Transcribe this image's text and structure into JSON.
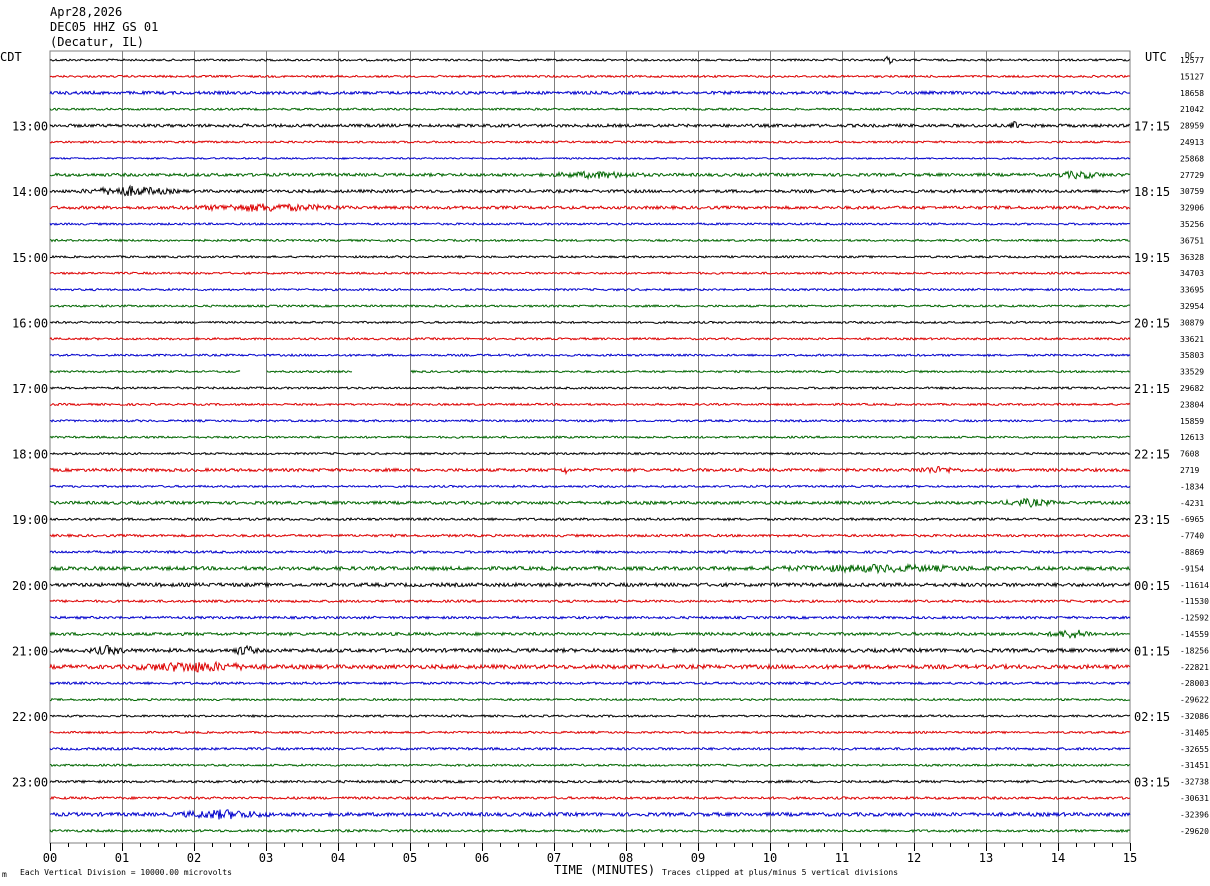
{
  "header": {
    "date": "Apr28,2026",
    "station": "DEC05 HHZ GS 01",
    "location": "(Decatur, IL)"
  },
  "left_tz": "CDT",
  "right_tz": "UTC",
  "dc_label": "DC",
  "footer": {
    "scale_note": "Each Vertical Division = 10000.00 microvolts",
    "xlabel": "TIME (MINUTES)",
    "clip_note": "Traces clipped at plus/minus 5 vertical divisions"
  },
  "colors": {
    "black": "#000000",
    "red": "#dd0000",
    "blue": "#0000cc",
    "green": "#006600",
    "grid": "#7f7f7f"
  },
  "chart_data": {
    "type": "line",
    "title": "DEC05 HHZ GS 01",
    "xlabel": "TIME (MINUTES)",
    "xlim": [
      0,
      15
    ],
    "x_ticks": [
      "00",
      "01",
      "02",
      "03",
      "04",
      "05",
      "06",
      "07",
      "08",
      "09",
      "10",
      "11",
      "12",
      "13",
      "14",
      "15"
    ],
    "trace_color_cycle": [
      "black",
      "red",
      "blue",
      "green"
    ],
    "hour_labels_left": [
      "13:00",
      "14:00",
      "15:00",
      "16:00",
      "17:00",
      "18:00",
      "19:00",
      "20:00",
      "21:00",
      "22:00",
      "23:00"
    ],
    "hour_labels_right": [
      "17:15",
      "18:15",
      "19:15",
      "20:15",
      "21:15",
      "22:15",
      "23:15",
      "00:15",
      "01:15",
      "02:15",
      "03:15"
    ],
    "dc_offsets": [
      "12577",
      "15127",
      "18658",
      "21042",
      "28959",
      "24913",
      "25868",
      "27729",
      "30759",
      "32906",
      "35256",
      "36751",
      "36328",
      "34703",
      "33695",
      "32954",
      "30879",
      "33621",
      "35803",
      "33529",
      "29682",
      "23804",
      "15859",
      "12613",
      "7608",
      "2719",
      "-1834",
      "-4231",
      "-6965",
      "-7740",
      "-8869",
      "-9154",
      "-11614",
      "-11530",
      "-12592",
      "-14559",
      "-18256",
      "-22821",
      "-28003",
      "-29622",
      "-32086",
      "-31405",
      "-32655",
      "-31451",
      "-32738",
      "-30631",
      "-32396",
      "-29620"
    ],
    "trace_amplitudes": [
      1.0,
      1.0,
      1.5,
      1.0,
      1.5,
      1.0,
      0.8,
      1.5,
      1.5,
      1.5,
      1.0,
      1.0,
      1.0,
      1.0,
      1.0,
      1.0,
      1.0,
      1.0,
      1.0,
      1.0,
      1.0,
      1.0,
      1.0,
      1.0,
      1.0,
      1.5,
      1.0,
      1.5,
      1.2,
      1.2,
      1.2,
      1.8,
      1.8,
      1.2,
      1.2,
      1.5,
      1.8,
      2.0,
      1.2,
      1.0,
      1.0,
      1.0,
      1.2,
      1.0,
      1.2,
      1.2,
      1.8,
      1.2
    ],
    "bursts": [
      {
        "trace": 0,
        "x": 11.65,
        "width": 0.15,
        "amp": 4
      },
      {
        "trace": 4,
        "x": 13.4,
        "width": 0.2,
        "amp": 3
      },
      {
        "trace": 7,
        "x": 7.6,
        "width": 1.5,
        "amp": 2.5
      },
      {
        "trace": 7,
        "x": 14.3,
        "width": 0.8,
        "amp": 3
      },
      {
        "trace": 8,
        "x": 1.1,
        "width": 1.5,
        "amp": 4
      },
      {
        "trace": 9,
        "x": 3.0,
        "width": 2.5,
        "amp": 3
      },
      {
        "trace": 25,
        "x": 7.15,
        "width": 0.1,
        "amp": 4
      },
      {
        "trace": 25,
        "x": 12.3,
        "width": 0.8,
        "amp": 2.5
      },
      {
        "trace": 27,
        "x": 13.6,
        "width": 0.9,
        "amp": 3
      },
      {
        "trace": 31,
        "x": 11.5,
        "width": 3.5,
        "amp": 2.5
      },
      {
        "trace": 35,
        "x": 14.2,
        "width": 0.8,
        "amp": 3.5
      },
      {
        "trace": 36,
        "x": 0.8,
        "width": 0.6,
        "amp": 3.5
      },
      {
        "trace": 36,
        "x": 2.7,
        "width": 0.4,
        "amp": 4
      },
      {
        "trace": 37,
        "x": 2.0,
        "width": 2.0,
        "amp": 4
      },
      {
        "trace": 46,
        "x": 2.4,
        "width": 1.5,
        "amp": 3.5
      }
    ],
    "gaps": [
      {
        "trace": 19,
        "x_start": 2.65,
        "x_end": 3.0
      },
      {
        "trace": 19,
        "x_start": 4.2,
        "x_end": 5.0
      }
    ]
  }
}
